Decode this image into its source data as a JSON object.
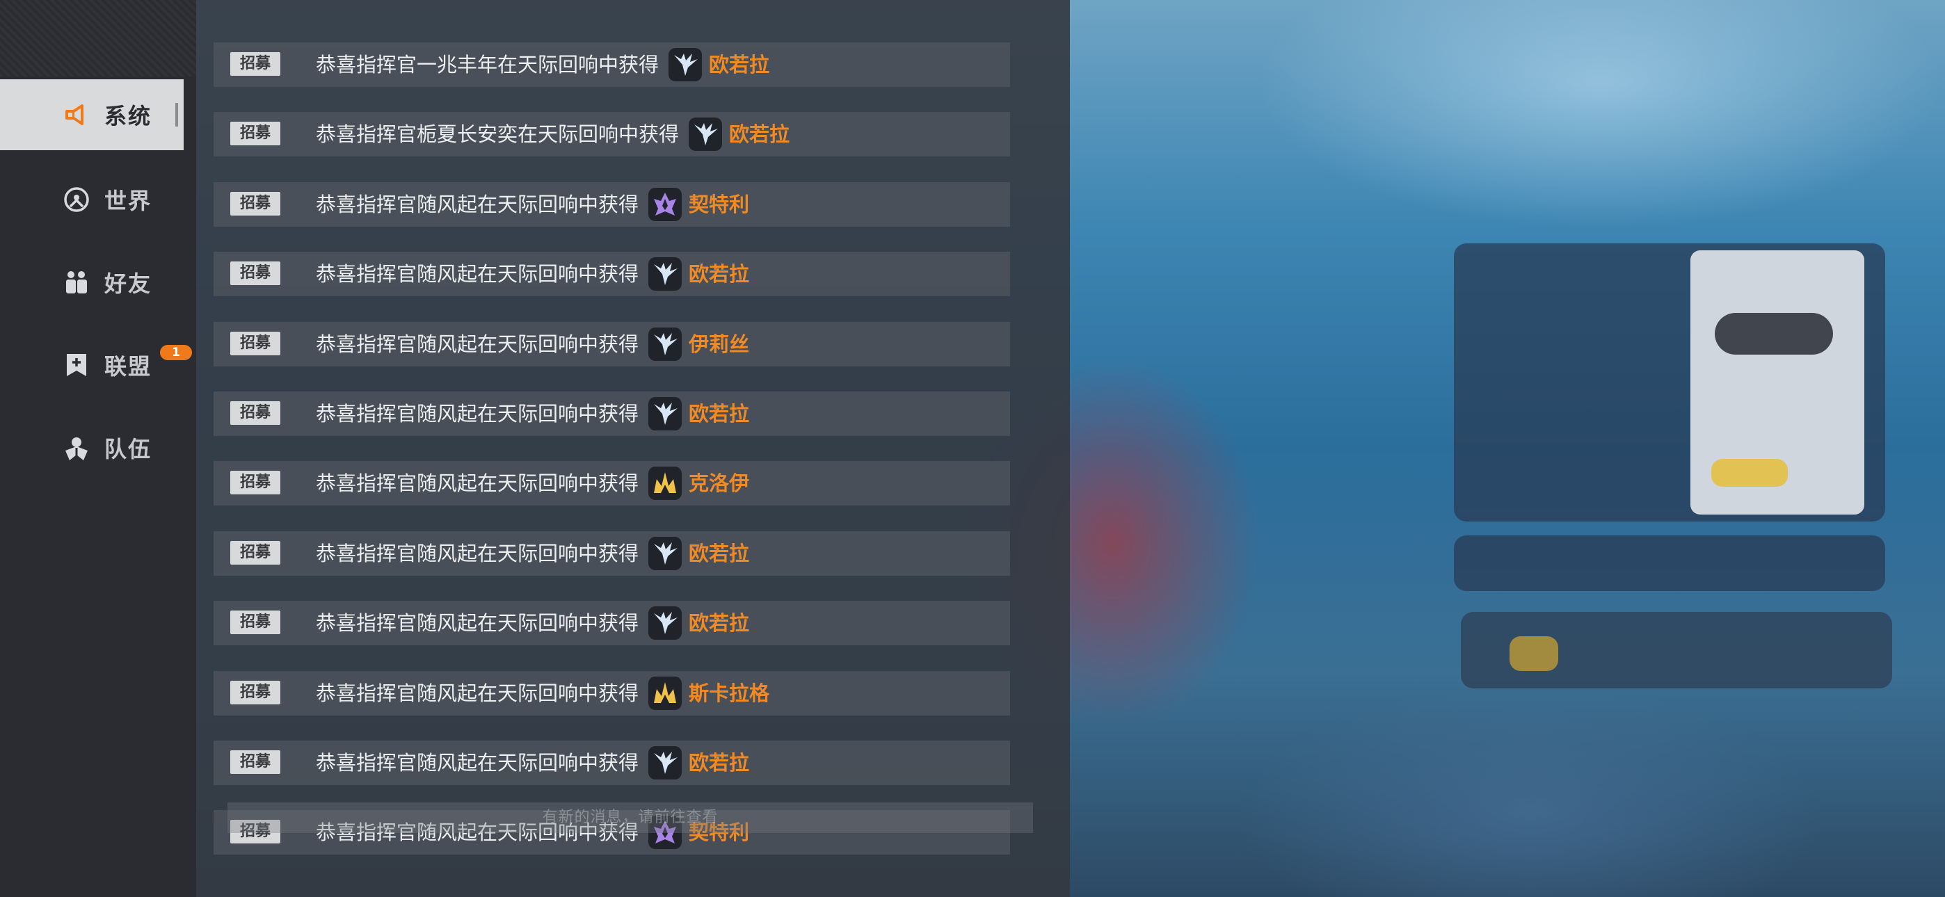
{
  "sidebar": {
    "items": [
      {
        "label": "系统",
        "icon": "megaphone-icon",
        "active": true
      },
      {
        "label": "世界",
        "icon": "globe-icon",
        "active": false
      },
      {
        "label": "好友",
        "icon": "friends-icon",
        "active": false
      },
      {
        "label": "联盟",
        "icon": "alliance-icon",
        "active": false,
        "badge": "1"
      },
      {
        "label": "队伍",
        "icon": "team-icon",
        "active": false
      }
    ]
  },
  "messages": [
    {
      "tag": "招募",
      "text": "恭喜指挥官一兆丰年在天际回响中获得",
      "character": "欧若拉",
      "icon": "wing-icon",
      "icon_color": "#d8e6f5"
    },
    {
      "tag": "招募",
      "text": "恭喜指挥官栀夏长安奕在天际回响中获得",
      "character": "欧若拉",
      "icon": "wing-icon",
      "icon_color": "#d8e6f5"
    },
    {
      "tag": "招募",
      "text": "恭喜指挥官随风起在天际回响中获得",
      "character": "契特利",
      "icon": "crest-icon",
      "icon_color": "#a884e8"
    },
    {
      "tag": "招募",
      "text": "恭喜指挥官随风起在天际回响中获得",
      "character": "欧若拉",
      "icon": "wing-icon",
      "icon_color": "#d8e6f5"
    },
    {
      "tag": "招募",
      "text": "恭喜指挥官随风起在天际回响中获得",
      "character": "伊莉丝",
      "icon": "wing-icon",
      "icon_color": "#d8e6f5"
    },
    {
      "tag": "招募",
      "text": "恭喜指挥官随风起在天际回响中获得",
      "character": "欧若拉",
      "icon": "wing-icon",
      "icon_color": "#d8e6f5"
    },
    {
      "tag": "招募",
      "text": "恭喜指挥官随风起在天际回响中获得",
      "character": "克洛伊",
      "icon": "crown-icon",
      "icon_color": "#f0c24a"
    },
    {
      "tag": "招募",
      "text": "恭喜指挥官随风起在天际回响中获得",
      "character": "欧若拉",
      "icon": "wing-icon",
      "icon_color": "#d8e6f5"
    },
    {
      "tag": "招募",
      "text": "恭喜指挥官随风起在天际回响中获得",
      "character": "欧若拉",
      "icon": "wing-icon",
      "icon_color": "#d8e6f5"
    },
    {
      "tag": "招募",
      "text": "恭喜指挥官随风起在天际回响中获得",
      "character": "斯卡拉格",
      "icon": "crown-icon",
      "icon_color": "#f0c24a"
    },
    {
      "tag": "招募",
      "text": "恭喜指挥官随风起在天际回响中获得",
      "character": "欧若拉",
      "icon": "wing-icon",
      "icon_color": "#d8e6f5"
    },
    {
      "tag": "招募",
      "text": "恭喜指挥官随风起在天际回响中获得",
      "character": "契特利",
      "icon": "crest-icon",
      "icon_color": "#a884e8"
    }
  ],
  "notice": "有新的消息，请前往查看",
  "colors": {
    "accent": "#f08a24",
    "badge": "#f07a1a"
  }
}
